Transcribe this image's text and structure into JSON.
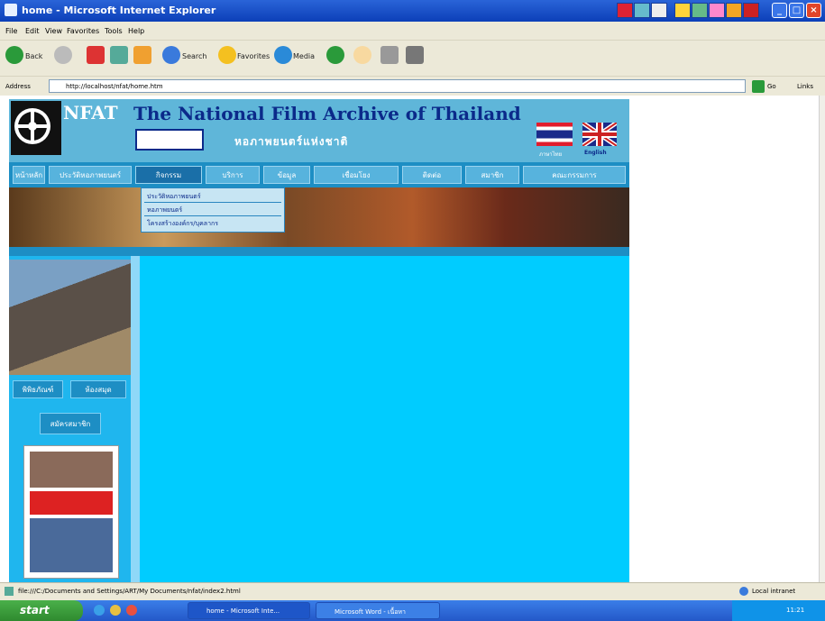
{
  "window": {
    "title": "home - Microsoft Internet Explorer"
  },
  "menu": [
    "File",
    "Edit",
    "View",
    "Favorites",
    "Tools",
    "Help"
  ],
  "toolbar": {
    "back": "Back",
    "search": "Search",
    "favorites": "Favorites",
    "media": "Media"
  },
  "address": {
    "label": "Address",
    "url": "http://localhost/nfat/home.htm",
    "go": "Go",
    "links": "Links"
  },
  "site": {
    "logo_text": "NFAT",
    "title": "The National Film Archive of Thailand",
    "thai_title": "หอภาพยนตร์แห่งชาติ",
    "lang_th": "ภาษาไทย",
    "lang_en": "English",
    "nav": [
      "หน้าหลัก",
      "ประวัติหอภาพยนตร์",
      "กิจกรรม",
      "บริการ",
      "ข้อมูล",
      "เชื่อมโยง",
      "ติดต่อ",
      "สมาชิก",
      "คณะกรรมการ"
    ],
    "dropdown": [
      "ประวัติหอภาพยนตร์",
      "หอภาพยนตร์",
      "โครงสร้างองค์กร/บุคลากร"
    ],
    "left_buttons": [
      "พิพิธภัณฑ์",
      "ห้องสมุด"
    ],
    "left_button_2": "สมัครสมาชิก"
  },
  "status": {
    "text": "file:///C:/Documents and Settings/ART/My Documents/nfat/index2.html",
    "zone": "Local intranet"
  },
  "taskbar": {
    "start": "start",
    "tasks": [
      "home - Microsoft Inte...",
      "Microsoft Word - เนื้อหา"
    ],
    "clock": "11:21"
  }
}
